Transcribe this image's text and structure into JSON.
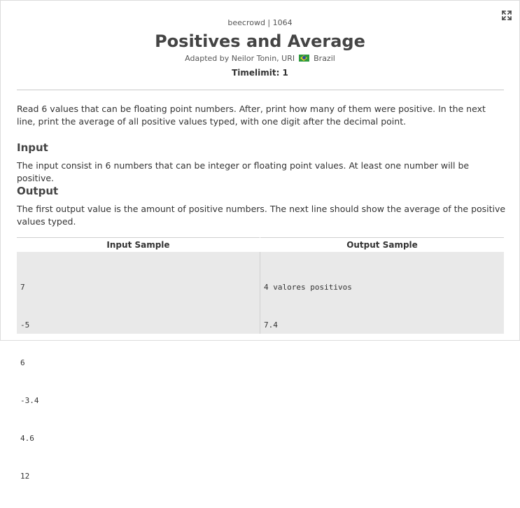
{
  "header": {
    "site": "beecrowd | 1064",
    "title": "Positives and Average",
    "adapted_prefix": "Adapted by Neilor Tonin, URI",
    "country": "Brazil",
    "timelimit": "Timelimit: 1"
  },
  "description": {
    "text": "Read 6 values that can be floating point numbers. After, print how many of them were positive. In the next line, print the average of all positive values typed, with one digit after the decimal point."
  },
  "input_section": {
    "heading": "Input",
    "text": "The input consist in 6 numbers that can be integer or floating point values. At least one number will be positive."
  },
  "output_section": {
    "heading": "Output",
    "text": "The first output value is the amount of positive numbers. The next line should show the average of the positive values typed."
  },
  "samples": {
    "input_header": "Input Sample",
    "output_header": "Output Sample",
    "input_lines": [
      "7",
      "-5",
      "6",
      "-3.4",
      "4.6",
      "12"
    ],
    "output_lines": [
      "4 valores positivos",
      "7.4"
    ]
  },
  "icons": {
    "expand": "fullscreen-expand-icon",
    "flag": "brazil-flag-icon"
  },
  "colors": {
    "sample_background": "#e9e9e9",
    "flag_green": "#2e9a3e",
    "flag_yellow": "#f2d320",
    "flag_blue": "#2b4e9e"
  }
}
